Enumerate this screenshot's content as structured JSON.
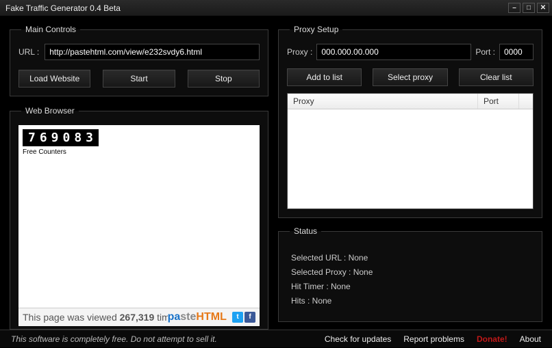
{
  "window": {
    "title": "Fake Traffic Generator 0.4 Beta"
  },
  "main_controls": {
    "legend": "Main Controls",
    "url_label": "URL :",
    "url_value": "http://pastehtml.com/view/e232svdy6.html",
    "load_btn": "Load Website",
    "start_btn": "Start",
    "stop_btn": "Stop"
  },
  "web_browser": {
    "legend": "Web Browser",
    "counter_value": "769083",
    "counter_caption": "Free Counters",
    "view_text_prefix": "This page was viewed ",
    "view_count": "267,319",
    "view_text_suffix": " tim",
    "logo_p1": "pa",
    "logo_p2": "ste",
    "logo_p3": "HTML"
  },
  "proxy_setup": {
    "legend": "Proxy Setup",
    "proxy_label": "Proxy :",
    "proxy_value": "000.000.00.000",
    "port_label": "Port :",
    "port_value": "0000",
    "add_btn": "Add to list",
    "select_btn": "Select proxy",
    "clear_btn": "Clear list",
    "col_proxy": "Proxy",
    "col_port": "Port"
  },
  "status": {
    "legend": "Status",
    "lines": {
      "url": "Selected URL :  None",
      "proxy": "Selected Proxy :  None",
      "timer": "Hit Timer :  None",
      "hits": "Hits :  None"
    }
  },
  "footer": {
    "note": "This software is completely free. Do not attempt to sell it.",
    "check": "Check for updates",
    "report": "Report problems",
    "donate": "Donate!",
    "about": "About"
  }
}
